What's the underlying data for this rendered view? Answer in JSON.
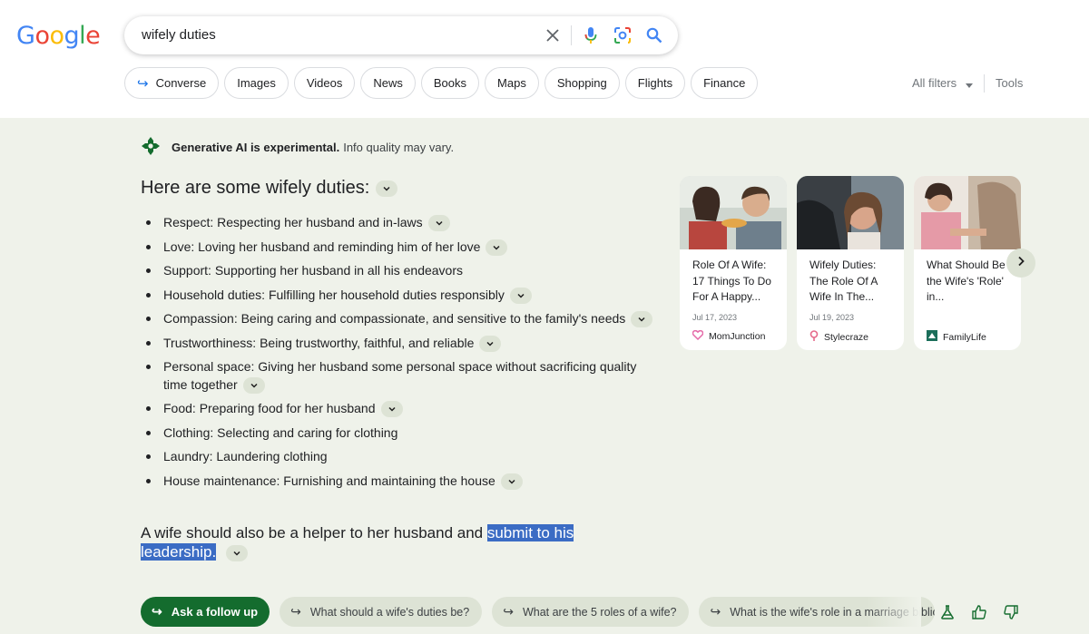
{
  "logo": [
    "G",
    "o",
    "o",
    "g",
    "l",
    "e"
  ],
  "logo_colors": [
    "#4285f4",
    "#ea4335",
    "#fbbc05",
    "#4285f4",
    "#34a853",
    "#ea4335"
  ],
  "search": {
    "query": "wifely duties"
  },
  "chips": [
    {
      "label": "Converse",
      "arrow": "↪"
    },
    {
      "label": "Images"
    },
    {
      "label": "Videos"
    },
    {
      "label": "News"
    },
    {
      "label": "Books"
    },
    {
      "label": "Maps"
    },
    {
      "label": "Shopping"
    },
    {
      "label": "Flights"
    },
    {
      "label": "Finance"
    }
  ],
  "filters": {
    "all_filters": "All filters",
    "tools": "Tools"
  },
  "sge": {
    "exp_bold": "Generative AI is experimental.",
    "exp_rest": "Info quality may vary.",
    "heading": "Here are some wifely duties:",
    "items": [
      {
        "text": "Respect: Respecting her husband and in-laws",
        "expand": true
      },
      {
        "text": "Love: Loving her husband and reminding him of her love",
        "expand": true
      },
      {
        "text": "Support: Supporting her husband in all his endeavors",
        "expand": false
      },
      {
        "text": "Household duties: Fulfilling her household duties responsibly",
        "expand": true
      },
      {
        "text": "Compassion: Being caring and compassionate, and sensitive to the family's needs",
        "expand": true
      },
      {
        "text": "Trustworthiness: Being trustworthy, faithful, and reliable",
        "expand": true
      },
      {
        "text": "Personal space: Giving her husband some personal space without sacrificing quality time together",
        "expand": true
      },
      {
        "text": "Food: Preparing food for her husband",
        "expand": true
      },
      {
        "text": "Clothing: Selecting and caring for clothing",
        "expand": false
      },
      {
        "text": "Laundry: Laundering clothing",
        "expand": false
      },
      {
        "text": "House maintenance: Furnishing and maintaining the house",
        "expand": true
      }
    ],
    "summary_plain": "A wife should also be a helper to her husband and",
    "summary_highlight": "submit to his leadership."
  },
  "cards": [
    {
      "title": "Role Of A Wife: 17 Things To Do For A Happy...",
      "date": "Jul 17, 2023",
      "source": "MomJunction",
      "src_color": "#e56aa8",
      "img_colors": [
        "#c9a883",
        "#7d5a44"
      ]
    },
    {
      "title": "Wifely Duties: The Role Of A Wife In The...",
      "date": "Jul 19, 2023",
      "source": "Stylecraze",
      "src_color": "#e56a8a",
      "img_colors": [
        "#5a6470",
        "#2e3034"
      ]
    },
    {
      "title": "What Should Be the Wife's 'Role' in...",
      "date": "",
      "source": "FamilyLife",
      "src_color": "#1b6e5a",
      "img_colors": [
        "#d8c7b6",
        "#a08874"
      ]
    }
  ],
  "followups": {
    "ask": "Ask a follow up",
    "suggestions": [
      "What should a wife's duties be?",
      "What are the 5 roles of a wife?",
      "What is the wife's role in a marriage biblic"
    ]
  }
}
